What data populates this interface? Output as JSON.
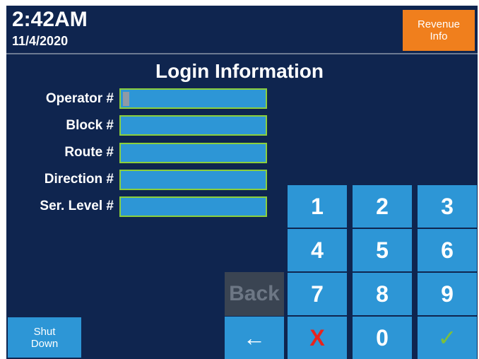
{
  "header": {
    "time": "2:42AM",
    "date": "11/4/2020",
    "revenue_button": "Revenue\nInfo"
  },
  "login": {
    "title": "Login Information",
    "fields": [
      {
        "label": "Operator #",
        "value": ""
      },
      {
        "label": "Block #",
        "value": ""
      },
      {
        "label": "Route #",
        "value": ""
      },
      {
        "label": "Direction #",
        "value": ""
      },
      {
        "label": "Ser. Level #",
        "value": ""
      }
    ]
  },
  "keypad": {
    "keys": [
      "1",
      "2",
      "3",
      "4",
      "5",
      "6",
      "7",
      "8",
      "9"
    ],
    "back_arrow": "←",
    "cancel": "X",
    "zero": "0",
    "confirm": "✓"
  },
  "buttons": {
    "back": "Back",
    "shutdown": "Shut\nDown"
  },
  "colors": {
    "background": "#0f254f",
    "field_fill": "#2d96d6",
    "field_border": "#8ccf3c",
    "revenue_button": "#f07f1d",
    "cancel_x": "#e8231d",
    "confirm_check": "#7dc03b"
  }
}
